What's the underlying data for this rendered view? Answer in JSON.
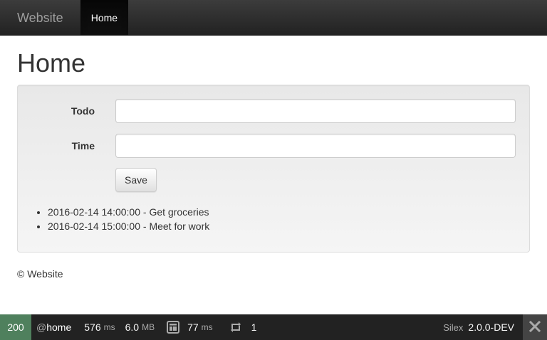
{
  "navbar": {
    "brand": "Website",
    "items": [
      {
        "label": "Home",
        "active": true
      }
    ]
  },
  "main": {
    "title": "Home",
    "form": {
      "todo_label": "Todo",
      "todo_value": "",
      "time_label": "Time",
      "time_value": "",
      "save_label": "Save"
    },
    "todos": [
      "2016-02-14 14:00:00 - Get groceries",
      "2016-02-14 15:00:00 - Meet for work"
    ]
  },
  "footer": {
    "text": "© Website"
  },
  "debug_toolbar": {
    "status_code": "200",
    "route_at": "@",
    "route_name": "home",
    "time_value": "576",
    "time_unit": "ms",
    "memory_value": "6.0",
    "memory_unit": "MB",
    "template_time_value": "77",
    "template_time_unit": "ms",
    "requests_count": "1",
    "framework_label": "Silex",
    "framework_version": "2.0.0-DEV",
    "status_color": "#4f805d",
    "icons": [
      "layout-icon",
      "refresh-icon",
      "close-icon"
    ]
  }
}
